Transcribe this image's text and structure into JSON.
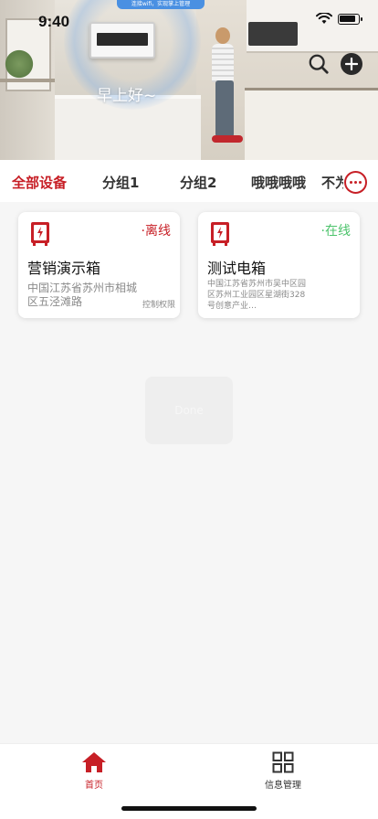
{
  "status_bar": {
    "time": "9:40",
    "wifi_banner": "连接wifi，实现掌上管理"
  },
  "hero": {
    "greeting": "早上好~"
  },
  "tabs": [
    {
      "label": "全部设备",
      "active": true
    },
    {
      "label": "分组1",
      "active": false
    },
    {
      "label": "分组2",
      "active": false
    },
    {
      "label": "哦哦哦哦",
      "active": false
    },
    {
      "label": "不为",
      "active": false
    }
  ],
  "devices": [
    {
      "name": "营销演示箱",
      "status": "·离线",
      "address": "中国江苏省苏州市相城区五泾滩路",
      "permission": "控制权限"
    },
    {
      "name": "测试电箱",
      "status": "·在线",
      "address": "中国江苏省苏州市吴中区园区苏州工业园区星湖街328号创意产业…"
    }
  ],
  "toast": "Done",
  "bottom_nav": {
    "home": "首页",
    "info": "信息管理"
  },
  "colors": {
    "accent": "#c71f26",
    "online": "#4cc36b",
    "background": "#f6f6f6"
  },
  "icons": [
    "search-icon",
    "add-icon",
    "more-icon",
    "electric-box-icon",
    "home-icon",
    "grid-icon",
    "wifi-icon",
    "battery-icon"
  ]
}
